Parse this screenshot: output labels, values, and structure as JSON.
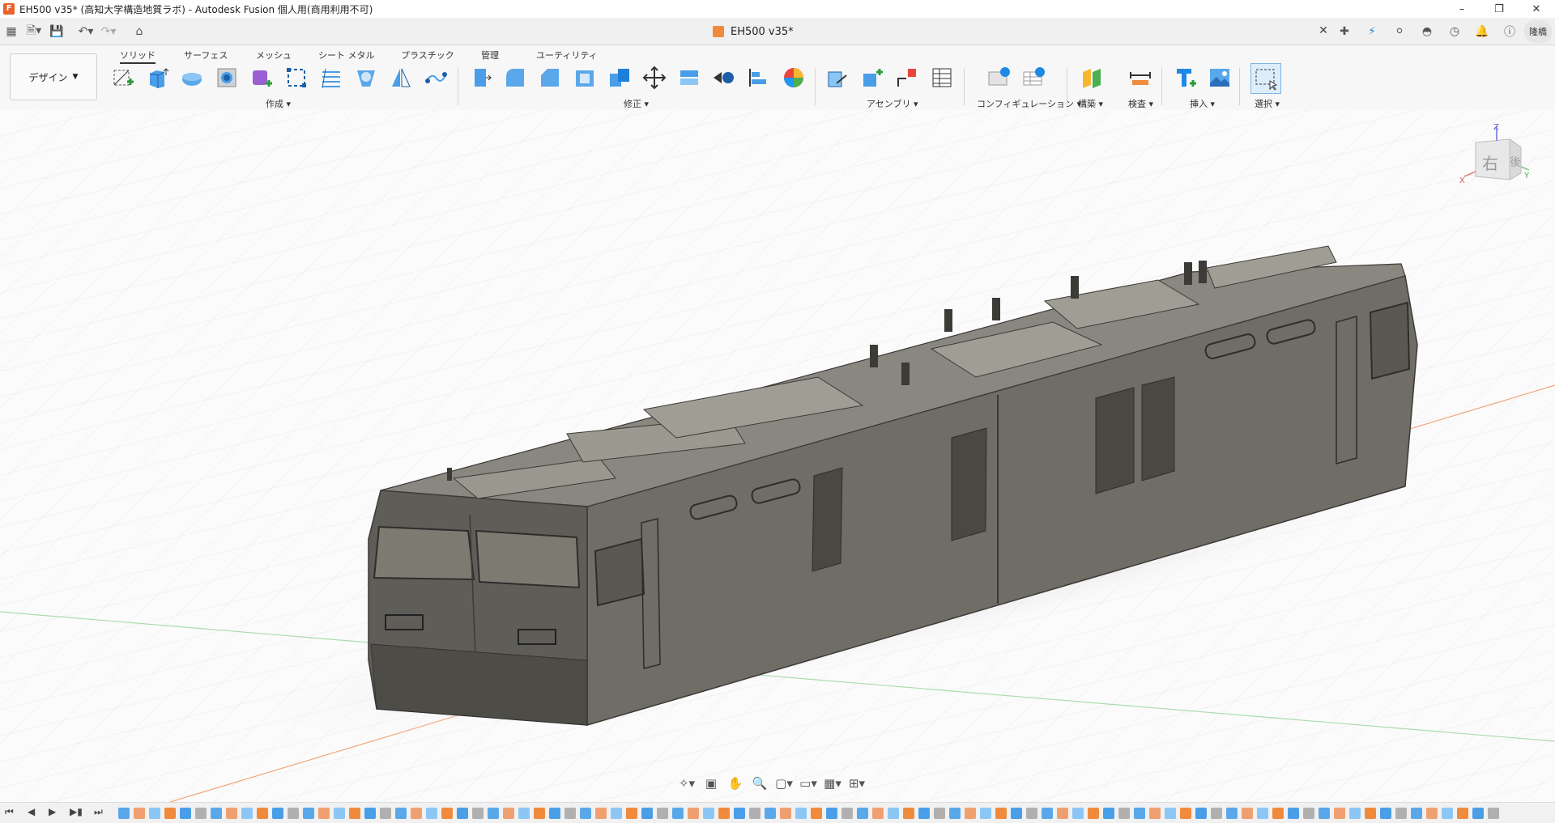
{
  "window": {
    "title": "EH500 v35* (高知大学構造地質ラボ) - Autodesk Fusion 個人用(商用利用不可)"
  },
  "document_tab": {
    "label": "EH500 v35*"
  },
  "user": {
    "initials": "隆橋"
  },
  "workspace": {
    "label": "デザイン"
  },
  "subtabs": [
    "ソリッド",
    "サーフェス",
    "メッシュ",
    "シート メタル",
    "プラスチック",
    "管理",
    "ユーティリティ"
  ],
  "groups": {
    "create": "作成",
    "modify": "修正",
    "assembly": "アセンブリ",
    "configuration": "コンフィギュレーション",
    "construct": "構築",
    "inspect": "検査",
    "insert": "挿入",
    "select": "選択"
  },
  "viewcube": {
    "face_right": "右",
    "face_back": "後",
    "axis_x": "X",
    "axis_y": "Y",
    "axis_z": "Z"
  },
  "colors": {
    "accent": "#1e88e5",
    "model_body": "#6f6d66",
    "axis_x": "#f0a070",
    "axis_y": "#8fd08f"
  }
}
